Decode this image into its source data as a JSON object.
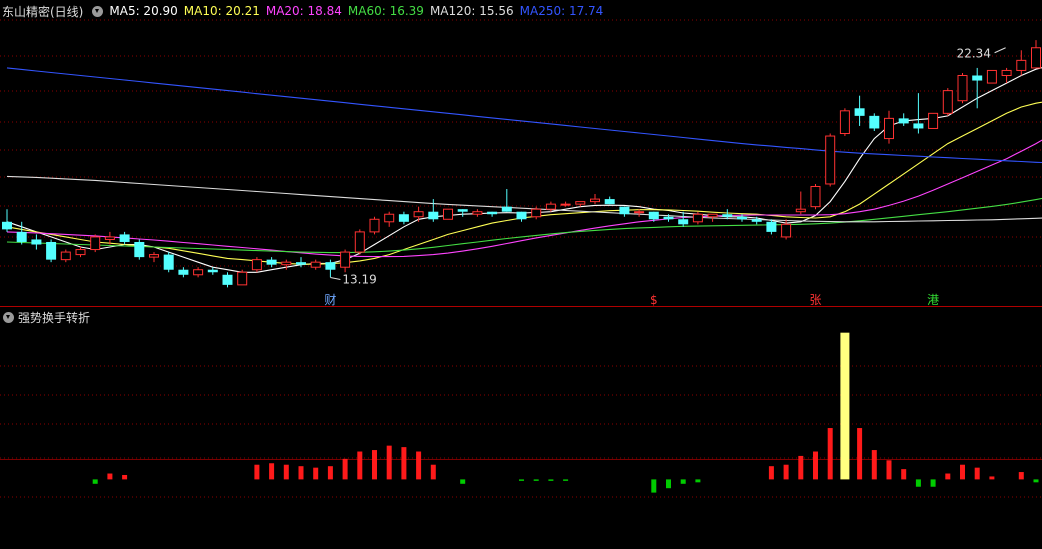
{
  "header": {
    "stock_name": "东山精密(日线)",
    "ma_legend": [
      {
        "label": "MA5: 20.90",
        "color": "#ffffff"
      },
      {
        "label": "MA10: 20.21",
        "color": "#ffff55"
      },
      {
        "label": "MA20: 18.84",
        "color": "#ff44ff"
      },
      {
        "label": "MA60: 16.39",
        "color": "#44dd44"
      },
      {
        "label": "MA120: 15.56",
        "color": "#dddddd"
      },
      {
        "label": "MA250: 17.74",
        "color": "#3355ff"
      }
    ]
  },
  "indicator": {
    "title": "强势换手转折"
  },
  "colors": {
    "up": "#ff3232",
    "down": "#54ffff",
    "grid": "#8b0000",
    "hbar_up": "#ff1a1a",
    "hbar_down": "#00cc00",
    "hbar_peak": "#ffff80"
  },
  "chart_data": [
    {
      "type": "candlestick",
      "title": "东山精密(日线)",
      "ylim": [
        12.3,
        23.4
      ],
      "annotations": [
        {
          "text": "22.34",
          "index": 68,
          "value": 22.34
        },
        {
          "text": "13.19",
          "index": 22,
          "value": 13.19
        }
      ],
      "event_markers": [
        {
          "text": "财",
          "index": 22,
          "color": "#6fa8ff"
        },
        {
          "text": "$",
          "index": 44,
          "color": "#ff3333"
        },
        {
          "text": "张",
          "index": 55,
          "color": "#ff3333"
        },
        {
          "text": "港",
          "index": 63,
          "color": "#33dd33"
        }
      ],
      "candles": [
        [
          15.4,
          15.9,
          15.0,
          15.1
        ],
        [
          15.0,
          15.4,
          14.5,
          14.6
        ],
        [
          14.7,
          14.9,
          14.3,
          14.5
        ],
        [
          14.6,
          14.7,
          13.8,
          13.9
        ],
        [
          13.9,
          14.3,
          13.8,
          14.2
        ],
        [
          14.1,
          14.4,
          14.0,
          14.3
        ],
        [
          14.3,
          14.9,
          14.2,
          14.8
        ],
        [
          14.7,
          15.0,
          14.5,
          14.8
        ],
        [
          14.9,
          15.0,
          14.5,
          14.6
        ],
        [
          14.6,
          14.7,
          13.9,
          14.0
        ],
        [
          14.0,
          14.2,
          13.8,
          14.1
        ],
        [
          14.1,
          14.2,
          13.4,
          13.5
        ],
        [
          13.5,
          13.6,
          13.2,
          13.3
        ],
        [
          13.3,
          13.6,
          13.2,
          13.5
        ],
        [
          13.5,
          13.6,
          13.3,
          13.4
        ],
        [
          13.3,
          13.4,
          12.8,
          12.9
        ],
        [
          12.9,
          13.5,
          12.9,
          13.4
        ],
        [
          13.5,
          14.0,
          13.4,
          13.9
        ],
        [
          13.9,
          14.0,
          13.6,
          13.7
        ],
        [
          13.7,
          13.9,
          13.5,
          13.8
        ],
        [
          13.8,
          14.0,
          13.6,
          13.7
        ],
        [
          13.6,
          13.9,
          13.5,
          13.8
        ],
        [
          13.8,
          13.9,
          13.2,
          13.5
        ],
        [
          13.6,
          14.3,
          13.4,
          14.2
        ],
        [
          14.2,
          15.1,
          14.1,
          15.0
        ],
        [
          15.0,
          15.6,
          14.9,
          15.5
        ],
        [
          15.4,
          15.8,
          15.2,
          15.7
        ],
        [
          15.7,
          15.8,
          15.3,
          15.4
        ],
        [
          15.6,
          16.0,
          15.4,
          15.8
        ],
        [
          15.8,
          16.3,
          15.4,
          15.5
        ],
        [
          15.5,
          15.9,
          15.5,
          15.9
        ],
        [
          15.9,
          15.9,
          15.6,
          15.8
        ],
        [
          15.7,
          15.9,
          15.6,
          15.8
        ],
        [
          15.8,
          15.8,
          15.6,
          15.7
        ],
        [
          16.0,
          16.7,
          15.8,
          15.8
        ],
        [
          15.8,
          15.8,
          15.4,
          15.5
        ],
        [
          15.6,
          16.0,
          15.5,
          15.9
        ],
        [
          15.9,
          16.2,
          15.8,
          16.1
        ],
        [
          16.1,
          16.2,
          16.0,
          16.1
        ],
        [
          16.1,
          16.2,
          16.0,
          16.2
        ],
        [
          16.2,
          16.5,
          16.1,
          16.3
        ],
        [
          16.3,
          16.4,
          16.1,
          16.1
        ],
        [
          16.0,
          16.0,
          15.6,
          15.7
        ],
        [
          15.8,
          15.9,
          15.6,
          15.8
        ],
        [
          15.8,
          15.8,
          15.4,
          15.5
        ],
        [
          15.6,
          15.7,
          15.4,
          15.5
        ],
        [
          15.5,
          15.8,
          15.2,
          15.3
        ],
        [
          15.4,
          15.8,
          15.3,
          15.7
        ],
        [
          15.6,
          15.7,
          15.4,
          15.7
        ],
        [
          15.7,
          15.9,
          15.5,
          15.6
        ],
        [
          15.6,
          15.7,
          15.4,
          15.5
        ],
        [
          15.5,
          15.6,
          15.3,
          15.4
        ],
        [
          15.4,
          15.5,
          14.9,
          15.0
        ],
        [
          14.8,
          15.5,
          14.7,
          15.3
        ],
        [
          15.8,
          16.6,
          15.7,
          15.9
        ],
        [
          16.0,
          16.9,
          15.9,
          16.8
        ],
        [
          16.9,
          18.9,
          16.8,
          18.8
        ],
        [
          18.9,
          19.9,
          18.8,
          19.8
        ],
        [
          19.9,
          20.4,
          19.2,
          19.6
        ],
        [
          19.6,
          19.7,
          19.0,
          19.1
        ],
        [
          18.7,
          19.8,
          18.5,
          19.5
        ],
        [
          19.5,
          19.7,
          19.2,
          19.3
        ],
        [
          19.3,
          20.5,
          18.9,
          19.1
        ],
        [
          19.1,
          19.7,
          19.1,
          19.7
        ],
        [
          19.7,
          20.7,
          19.6,
          20.6
        ],
        [
          20.2,
          21.3,
          20.1,
          21.2
        ],
        [
          21.2,
          21.5,
          19.9,
          21.0
        ],
        [
          20.9,
          21.4,
          20.9,
          21.4
        ],
        [
          21.2,
          21.5,
          20.9,
          21.4
        ],
        [
          21.4,
          22.2,
          21.2,
          21.8
        ],
        [
          21.5,
          22.6,
          21.5,
          22.3
        ],
        [
          21.9,
          22.2,
          20.9,
          21.5
        ]
      ],
      "series": [
        {
          "name": "MA5",
          "color": "#ffffff",
          "values": [
            15.4,
            15.2,
            15.0,
            14.8,
            14.6,
            14.4,
            14.3,
            14.4,
            14.5,
            14.5,
            14.4,
            14.2,
            14.0,
            13.8,
            13.6,
            13.5,
            13.4,
            13.4,
            13.5,
            13.6,
            13.7,
            13.75,
            13.75,
            13.9,
            14.15,
            14.5,
            14.85,
            15.2,
            15.5,
            15.6,
            15.65,
            15.7,
            15.72,
            15.75,
            15.76,
            15.75,
            15.77,
            15.8,
            15.9,
            16.0,
            16.05,
            16.06,
            16.05,
            16.0,
            15.9,
            15.85,
            15.75,
            15.7,
            15.65,
            15.6,
            15.6,
            15.55,
            15.45,
            15.35,
            15.4,
            15.65,
            16.2,
            17.0,
            17.9,
            18.7,
            19.2,
            19.4,
            19.45,
            19.5,
            19.6,
            19.95,
            20.3,
            20.6,
            20.9,
            21.2,
            21.45,
            21.6
          ]
        },
        {
          "name": "MA10",
          "color": "#ffff55",
          "values": [
            15.2,
            15.1,
            15.0,
            14.9,
            14.8,
            14.7,
            14.6,
            14.55,
            14.5,
            14.45,
            14.4,
            14.35,
            14.25,
            14.15,
            14.05,
            13.95,
            13.9,
            13.85,
            13.8,
            13.75,
            13.72,
            13.72,
            13.74,
            13.78,
            13.85,
            13.95,
            14.1,
            14.3,
            14.5,
            14.7,
            14.9,
            15.05,
            15.2,
            15.35,
            15.45,
            15.55,
            15.62,
            15.68,
            15.72,
            15.76,
            15.8,
            15.84,
            15.86,
            15.88,
            15.88,
            15.87,
            15.85,
            15.82,
            15.78,
            15.75,
            15.72,
            15.7,
            15.65,
            15.6,
            15.57,
            15.55,
            15.6,
            15.8,
            16.1,
            16.5,
            16.9,
            17.3,
            17.7,
            18.1,
            18.5,
            18.8,
            19.1,
            19.4,
            19.7,
            19.95,
            20.1,
            20.2
          ]
        },
        {
          "name": "MA20",
          "color": "#ff44ff",
          "values": [
            15.0,
            14.98,
            14.96,
            14.93,
            14.9,
            14.87,
            14.84,
            14.8,
            14.76,
            14.72,
            14.68,
            14.63,
            14.58,
            14.53,
            14.48,
            14.43,
            14.38,
            14.33,
            14.28,
            14.22,
            14.17,
            14.12,
            14.08,
            14.05,
            14.03,
            14.02,
            14.02,
            14.03,
            14.06,
            14.1,
            14.16,
            14.24,
            14.33,
            14.43,
            14.54,
            14.65,
            14.76,
            14.86,
            14.96,
            15.06,
            15.15,
            15.24,
            15.32,
            15.4,
            15.46,
            15.52,
            15.57,
            15.6,
            15.63,
            15.65,
            15.66,
            15.67,
            15.67,
            15.67,
            15.67,
            15.67,
            15.68,
            15.72,
            15.8,
            15.9,
            16.05,
            16.22,
            16.42,
            16.65,
            16.9,
            17.15,
            17.4,
            17.65,
            17.9,
            18.2,
            18.5,
            18.84
          ]
        },
        {
          "name": "MA60",
          "color": "#44dd44",
          "values": [
            14.6,
            14.58,
            14.56,
            14.54,
            14.52,
            14.5,
            14.48,
            14.46,
            14.44,
            14.42,
            14.4,
            14.38,
            14.36,
            14.34,
            14.32,
            14.3,
            14.28,
            14.26,
            14.24,
            14.22,
            14.2,
            14.19,
            14.18,
            14.18,
            14.19,
            14.21,
            14.24,
            14.28,
            14.33,
            14.39,
            14.46,
            14.53,
            14.6,
            14.67,
            14.74,
            14.8,
            14.86,
            14.92,
            14.97,
            15.02,
            15.06,
            15.1,
            15.13,
            15.16,
            15.18,
            15.2,
            15.22,
            15.23,
            15.24,
            15.25,
            15.26,
            15.27,
            15.28,
            15.29,
            15.3,
            15.32,
            15.35,
            15.39,
            15.44,
            15.5,
            15.56,
            15.62,
            15.68,
            15.74,
            15.8,
            15.87,
            15.94,
            16.01,
            16.09,
            16.18,
            16.28,
            16.39
          ]
        },
        {
          "name": "MA120",
          "color": "#dddddd",
          "values": [
            17.2,
            17.18,
            17.16,
            17.13,
            17.1,
            17.07,
            17.04,
            17.0,
            16.96,
            16.92,
            16.88,
            16.84,
            16.8,
            16.76,
            16.72,
            16.68,
            16.64,
            16.6,
            16.56,
            16.52,
            16.48,
            16.44,
            16.4,
            16.36,
            16.32,
            16.28,
            16.24,
            16.2,
            16.16,
            16.12,
            16.09,
            16.06,
            16.03,
            16.0,
            15.97,
            15.94,
            15.91,
            15.88,
            15.85,
            15.82,
            15.79,
            15.76,
            15.73,
            15.7,
            15.67,
            15.64,
            15.61,
            15.58,
            15.55,
            15.53,
            15.51,
            15.49,
            15.47,
            15.45,
            15.43,
            15.42,
            15.41,
            15.4,
            15.4,
            15.4,
            15.41,
            15.42,
            15.43,
            15.44,
            15.45,
            15.46,
            15.47,
            15.48,
            15.5,
            15.52,
            15.54,
            15.56
          ]
        },
        {
          "name": "MA250",
          "color": "#3355ff",
          "values": [
            21.5,
            21.44,
            21.38,
            21.32,
            21.26,
            21.2,
            21.14,
            21.08,
            21.02,
            20.96,
            20.9,
            20.84,
            20.78,
            20.72,
            20.66,
            20.6,
            20.54,
            20.48,
            20.42,
            20.36,
            20.3,
            20.24,
            20.18,
            20.12,
            20.06,
            20.0,
            19.94,
            19.88,
            19.82,
            19.76,
            19.7,
            19.64,
            19.58,
            19.52,
            19.46,
            19.4,
            19.34,
            19.28,
            19.22,
            19.16,
            19.1,
            19.04,
            18.98,
            18.92,
            18.86,
            18.8,
            18.74,
            18.68,
            18.62,
            18.56,
            18.5,
            18.45,
            18.4,
            18.35,
            18.3,
            18.25,
            18.2,
            18.16,
            18.12,
            18.09,
            18.06,
            18.03,
            18.0,
            17.97,
            17.94,
            17.91,
            17.88,
            17.85,
            17.82,
            17.79,
            17.76,
            17.74
          ]
        }
      ]
    },
    {
      "type": "bar",
      "title": "强势换手转折",
      "ylim": [
        -1.2,
        11
      ],
      "values": [
        0,
        0,
        0,
        0,
        0,
        0,
        -0.3,
        0.4,
        0.3,
        0,
        0,
        0,
        0,
        0,
        0,
        0,
        0,
        1.0,
        1.1,
        1.0,
        0.9,
        0.8,
        0.9,
        1.4,
        1.9,
        2.0,
        2.3,
        2.2,
        1.9,
        1.0,
        0,
        -0.3,
        0,
        0,
        0,
        -0.1,
        -0.1,
        -0.1,
        -0.1,
        0,
        0,
        0,
        0,
        0,
        -0.9,
        -0.6,
        -0.3,
        -0.2,
        0,
        0,
        0,
        0,
        0.9,
        1.0,
        1.6,
        1.9,
        3.5,
        10.0,
        3.5,
        2.0,
        1.3,
        0.7,
        -0.5,
        -0.5,
        0.4,
        1.0,
        0.8,
        0.2,
        0,
        0.5,
        -0.2
      ]
    }
  ]
}
